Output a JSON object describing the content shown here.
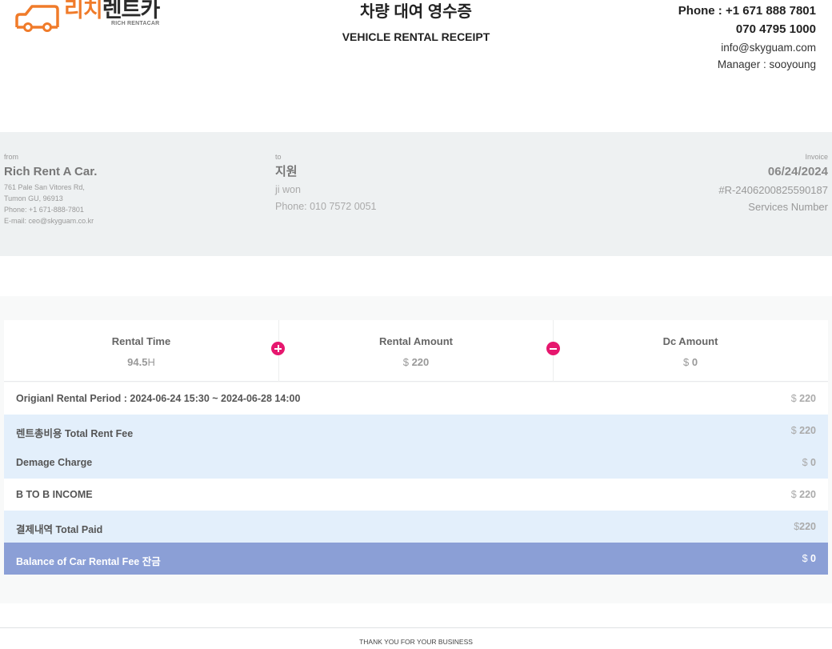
{
  "logo": {
    "text_orange": "리치",
    "text_dark": "렌트카",
    "sub": "RICH RENTACAR",
    "brand_color": "#f07b2a"
  },
  "title": {
    "ko": "차량 대여 영수증",
    "en": "VEHICLE RENTAL RECEIPT"
  },
  "contact": {
    "phone": "Phone : +1 671 888 7801",
    "phone2": "070 4795 1000",
    "email": "info@skyguam.com",
    "manager": "Manager : sooyoung"
  },
  "from": {
    "label": "from",
    "name": "Rich Rent A Car.",
    "address1": "761 Pale San Vitores Rd,",
    "address2": "Tumon GU, 96913",
    "phone": "Phone: +1 671-888-7801",
    "email": "E-mail: ceo@skyguam.co.kr"
  },
  "to": {
    "label": "to",
    "name": "지원",
    "name_en": "ji won",
    "phone": "Phone: 010 7572 0051"
  },
  "invoice": {
    "label": "Invoice",
    "date": "06/24/2024",
    "number": "#R-2406200825590187",
    "services": "Services Number"
  },
  "summary": {
    "rental_time_label": "Rental Time",
    "rental_time_value": "94.5",
    "rental_time_unit": "H",
    "rental_amount_label": "Rental Amount",
    "rental_amount_currency": "$",
    "rental_amount_value": "220",
    "dc_amount_label": "Dc Amount",
    "dc_amount_currency": "$",
    "dc_amount_value": "0",
    "plus_icon": "plus-circle-icon",
    "minus_icon": "minus-circle-icon",
    "icon_color": "#e6176e"
  },
  "rows": [
    {
      "label": "Origianl Rental Period : 2024-06-24 15:30 ~ 2024-06-28 14:00",
      "currency": "$",
      "value": "220"
    },
    {
      "label": "렌트총비용 Total Rent Fee",
      "currency": "$",
      "value": "220"
    },
    {
      "label": "Demage Charge",
      "currency": "$",
      "value": "0"
    },
    {
      "label": "B TO B INCOME",
      "currency": "$",
      "value": "220"
    },
    {
      "label": "결제내역 Total Paid",
      "currency": "$",
      "value": "220"
    },
    {
      "label": "Balance of Car Rental Fee 잔금",
      "currency": "$",
      "value": "0"
    }
  ],
  "colors": {
    "info_bg": "#eef1f2",
    "row_blue": "#e3effb",
    "row_balance": "#8b9fd6"
  },
  "footer": "THANK YOU FOR YOUR BUSINESS"
}
